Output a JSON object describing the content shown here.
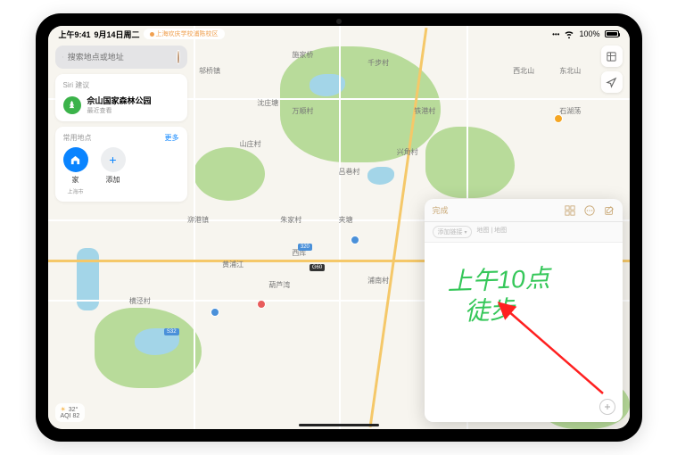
{
  "status": {
    "time": "上午9:41",
    "date": "9月14日周二",
    "location_pill": "上海欢庆学校浦陈校区",
    "signal": "wifi",
    "battery_pct": "100%"
  },
  "search": {
    "placeholder": "搜索地点或地址"
  },
  "siri": {
    "section_label": "Siri 建议",
    "name": "佘山国家森林公园",
    "subtitle": "最近查看"
  },
  "favorites": {
    "section_label": "常用地点",
    "more": "更多",
    "home_label": "家",
    "home_sub": "上海市",
    "add_label": "添加"
  },
  "map_labels": {
    "l1": "邬桥镇",
    "l2": "施家桥",
    "l3": "沈庄塘",
    "l4": "千步村",
    "l5": "万顺村",
    "l6": "山庄村",
    "l7": "泖港镇",
    "l8": "朱家村",
    "l9": "夹塘",
    "l10": "兴角村",
    "l11": "横泾村",
    "l12": "黄浦江",
    "l13": "西厍",
    "l14": "浦南村",
    "l15": "西北山",
    "l16": "东北山",
    "l17": "石湖荡",
    "l18": "铁港村",
    "l19": "吕巷村",
    "l20": "葫芦湾"
  },
  "route_badges": {
    "r1": "G60",
    "r2": "S32",
    "r3": "320"
  },
  "weather": {
    "temp": "32°",
    "aqi": "AQI 82"
  },
  "notes": {
    "done": "完成",
    "add_link": "添加链接",
    "meta": "地图 | 地图",
    "line1": "上午10点",
    "line2": "徒步"
  }
}
